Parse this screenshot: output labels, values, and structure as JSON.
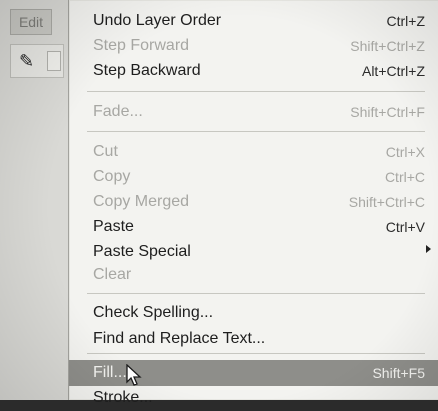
{
  "sidebar": {
    "edit_label": "Edit"
  },
  "menu": {
    "items": [
      {
        "label": "Undo Layer Order",
        "shortcut": "Ctrl+Z",
        "enabled": true
      },
      {
        "label": "Step Forward",
        "shortcut": "Shift+Ctrl+Z",
        "enabled": false
      },
      {
        "label": "Step Backward",
        "shortcut": "Alt+Ctrl+Z",
        "enabled": true
      },
      {
        "label": "Fade...",
        "shortcut": "Shift+Ctrl+F",
        "enabled": false
      },
      {
        "label": "Cut",
        "shortcut": "Ctrl+X",
        "enabled": false
      },
      {
        "label": "Copy",
        "shortcut": "Ctrl+C",
        "enabled": false
      },
      {
        "label": "Copy Merged",
        "shortcut": "Shift+Ctrl+C",
        "enabled": false
      },
      {
        "label": "Paste",
        "shortcut": "Ctrl+V",
        "enabled": true
      },
      {
        "label": "Paste Special",
        "shortcut": "",
        "enabled": true
      },
      {
        "label": "Clear",
        "shortcut": "",
        "enabled": false
      },
      {
        "label": "Check Spelling...",
        "shortcut": "",
        "enabled": true
      },
      {
        "label": "Find and Replace Text...",
        "shortcut": "",
        "enabled": true
      },
      {
        "label": "Fill...",
        "shortcut": "Shift+F5",
        "enabled": true
      },
      {
        "label": "Stroke...",
        "shortcut": "",
        "enabled": true
      }
    ]
  }
}
